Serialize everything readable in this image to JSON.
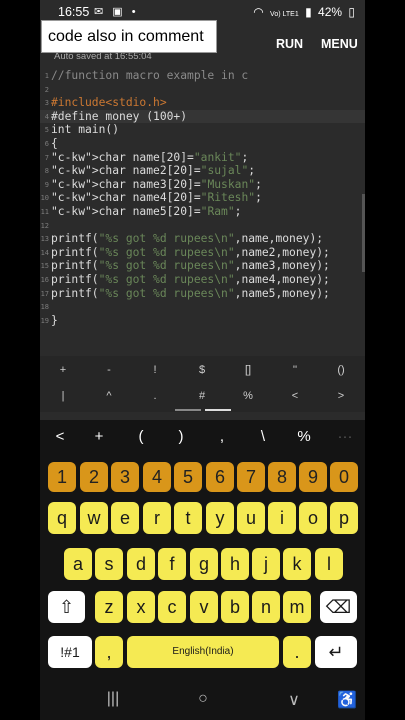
{
  "status_bar": {
    "time": "16:55",
    "left_icons": "✉ ▣ •",
    "signal": "Vo) LTE1",
    "battery": "42%"
  },
  "app_bar": {
    "run_label": "RUN",
    "menu_label": "MENU",
    "autosave_text": "Auto saved at 16:55:04"
  },
  "overlay": {
    "text": "code also in comment"
  },
  "editor": {
    "lines": [
      {
        "num": "1",
        "code": "//function macro example in c"
      },
      {
        "num": "2",
        "code": ""
      },
      {
        "num": "3",
        "code": "#include<stdio.h>"
      },
      {
        "num": "4",
        "code": "#define money (100+)"
      },
      {
        "num": "5",
        "code": "int main()"
      },
      {
        "num": "6",
        "code": "{"
      },
      {
        "num": "7",
        "code": "char name[20]=\"ankit\";"
      },
      {
        "num": "8",
        "code": "char name2[20]=\"sujal\";"
      },
      {
        "num": "9",
        "code": "char name3[20]=\"Muskan\";"
      },
      {
        "num": "10",
        "code": "char name4[20]=\"Ritesh\";"
      },
      {
        "num": "11",
        "code": "char name5[20]=\"Ram\";"
      },
      {
        "num": "12",
        "code": ""
      },
      {
        "num": "13",
        "code": "printf(\"%s got %d rupees\\n\",name,money);"
      },
      {
        "num": "14",
        "code": "printf(\"%s got %d rupees\\n\",name2,money);"
      },
      {
        "num": "15",
        "code": "printf(\"%s got %d rupees\\n\",name3,money);"
      },
      {
        "num": "16",
        "code": "printf(\"%s got %d rupees\\n\",name4,money);"
      },
      {
        "num": "17",
        "code": "printf(\"%s got %d rupees\\n\",name5,money);"
      },
      {
        "num": "18",
        "code": ""
      },
      {
        "num": "19",
        "code": "}"
      }
    ]
  },
  "symbols": {
    "row1": [
      "+",
      "-",
      "!",
      "$",
      "[]",
      "''",
      "()"
    ],
    "row2": [
      "|",
      "^",
      ".",
      "#",
      "%",
      "<",
      ">"
    ]
  },
  "keyboard_toolbar": [
    "<",
    "+",
    "(",
    ")",
    ",",
    "\\",
    "%",
    "···"
  ],
  "keyboard": {
    "numbers": [
      "1",
      "2",
      "3",
      "4",
      "5",
      "6",
      "7",
      "8",
      "9",
      "0"
    ],
    "row1": [
      "q",
      "w",
      "e",
      "r",
      "t",
      "y",
      "u",
      "i",
      "o",
      "p"
    ],
    "row2": [
      "a",
      "s",
      "d",
      "f",
      "g",
      "h",
      "j",
      "k",
      "l"
    ],
    "row3": [
      "z",
      "x",
      "c",
      "v",
      "b",
      "n",
      "m"
    ],
    "shift": "⇧",
    "backspace": "⌫",
    "symbols_key": "!#1",
    "comma": ",",
    "space_label": "English(India)",
    "period": ".",
    "enter": "↵"
  },
  "nav_bar": {
    "recents": "|||",
    "home": "○",
    "back": "∨",
    "accessibility": "♿"
  },
  "colors": {
    "key_yellow": "#f5ea53",
    "number_orange": "#d9961a",
    "editor_bg": "#2b2b2b"
  }
}
